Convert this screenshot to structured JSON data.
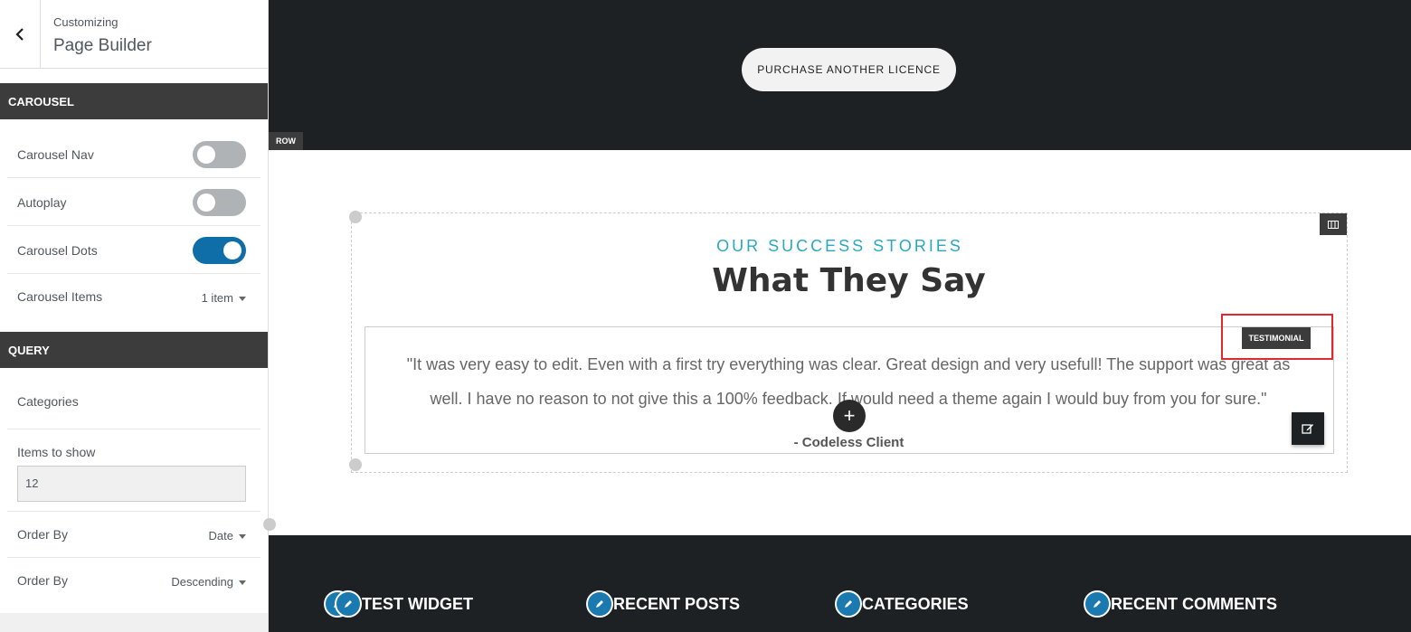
{
  "sidebar": {
    "crumb": "Customizing",
    "title": "Page Builder",
    "carousel_section": "CAROUSEL",
    "carousel_nav_label": "Carousel Nav",
    "autoplay_label": "Autoplay",
    "carousel_dots_label": "Carousel Dots",
    "carousel_items_label": "Carousel Items",
    "carousel_items_value": "1 item",
    "query_section": "QUERY",
    "categories_label": "Categories",
    "items_to_show_label": "Items to show",
    "items_to_show_value": "12",
    "order_by_label": "Order By",
    "order_by_value": "Date",
    "order_label": "Order By",
    "order_value": "Descending",
    "toggles": {
      "carousel_nav": false,
      "autoplay": false,
      "carousel_dots": true
    }
  },
  "preview": {
    "purchase_button": "PURCHASE ANOTHER LICENCE",
    "row_tag": "ROW",
    "subtitle": "OUR SUCCESS STORIES",
    "heading": "What They Say",
    "quote": "\"It was very easy to edit. Even with a first try everything was clear. Great design and very usefull! The support was great as well. I have no reason to not give this a 100% feedback. If would need a theme again I would buy from you for sure.\"",
    "author": "- Codeless Client",
    "testimonial_tag": "TESTIMONIAL",
    "plus": "+",
    "widgets": [
      "TEST WIDGET",
      "RECENT POSTS",
      "CATEGORIES",
      "RECENT COMMENTS"
    ]
  },
  "colors": {
    "accent": "#2aa8c2",
    "toggle_on": "#0f6ea8",
    "highlight": "#e0282e",
    "dark": "#1e2124"
  }
}
